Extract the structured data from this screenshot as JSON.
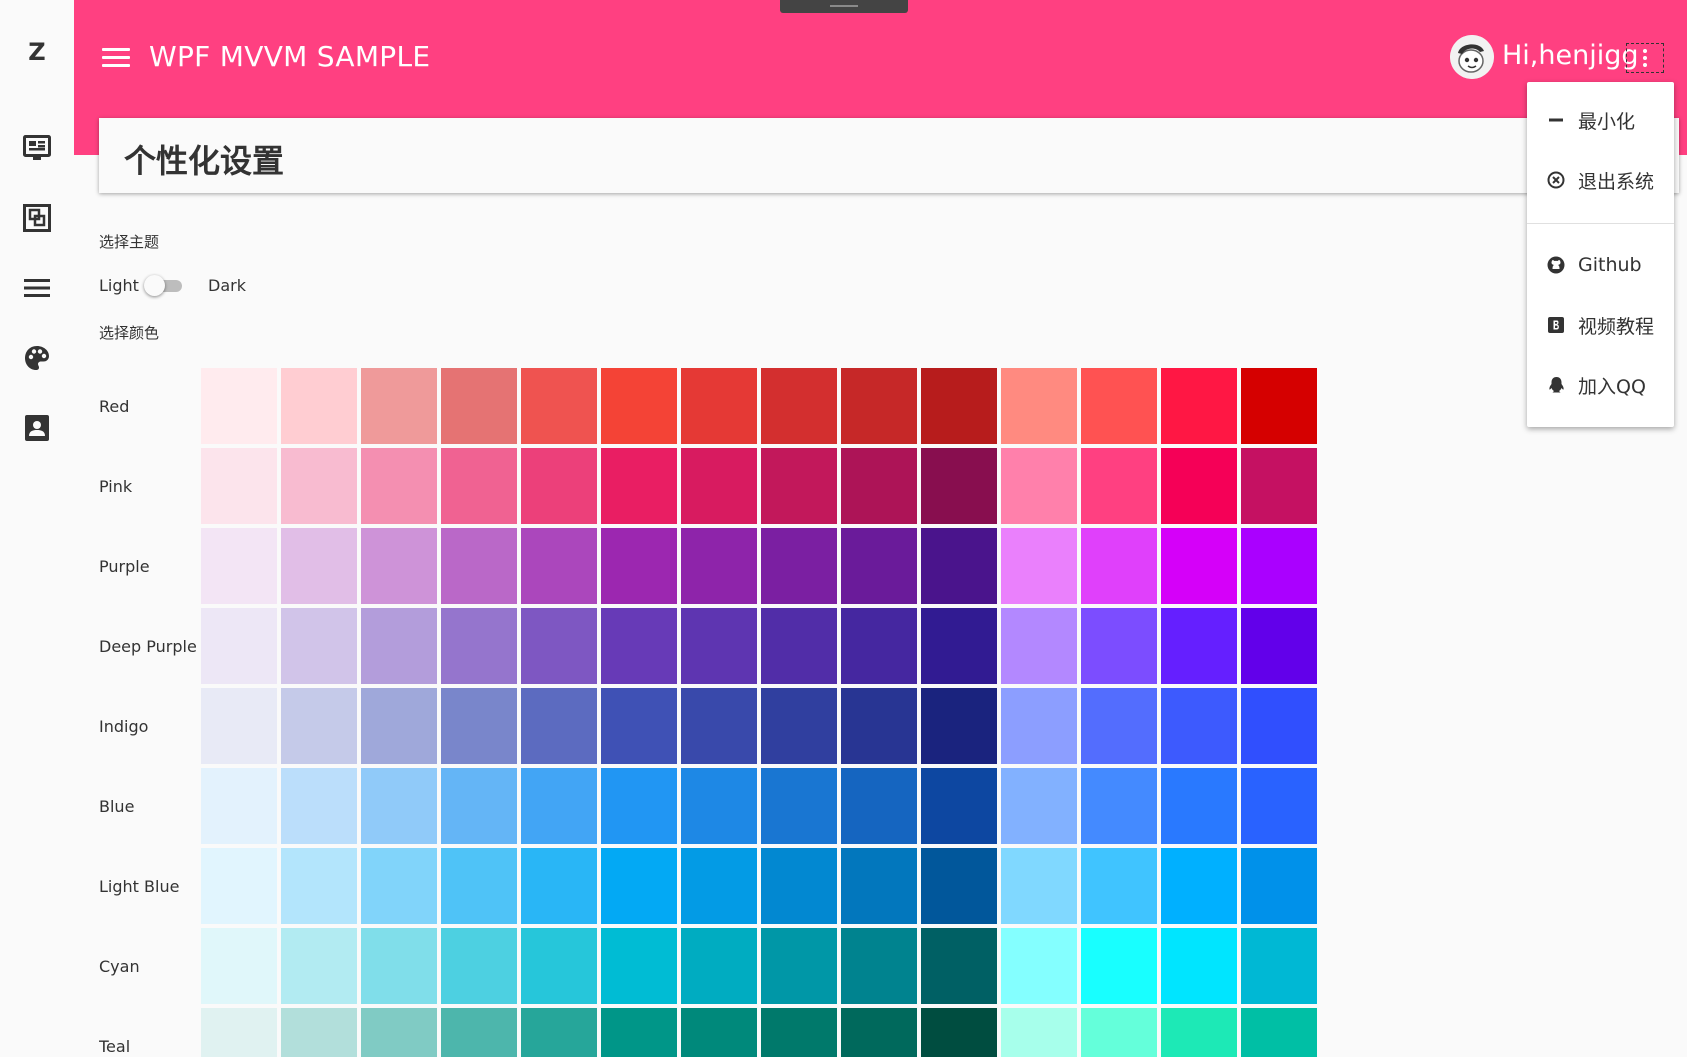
{
  "app": {
    "logo": "Z",
    "title": "WPF MVVM SAMPLE",
    "greeting": "Hi,henjigg",
    "accent_color": "#ff4081"
  },
  "sidebar": {
    "items": [
      {
        "icon": "dashboard-icon"
      },
      {
        "icon": "layers-icon"
      },
      {
        "icon": "menu-list-icon"
      },
      {
        "icon": "palette-icon"
      },
      {
        "icon": "contact-card-icon"
      }
    ]
  },
  "page": {
    "title": "个性化设置",
    "theme_label": "选择主题",
    "light_label": "Light",
    "dark_label": "Dark",
    "dark_mode_enabled": false,
    "color_label": "选择颜色"
  },
  "menu": {
    "items": [
      {
        "icon": "minimize-icon",
        "label": "最小化"
      },
      {
        "icon": "exit-circle-icon",
        "label": "退出系统"
      },
      {
        "icon": "github-icon",
        "label": "Github"
      },
      {
        "icon": "bilibili-icon",
        "label": "视频教程"
      },
      {
        "icon": "qq-icon",
        "label": "加入QQ"
      }
    ]
  },
  "palettes": [
    {
      "name": "Red",
      "colors": [
        "#ffebee",
        "#ffcdd2",
        "#ef9a9a",
        "#e57373",
        "#ef5350",
        "#f44336",
        "#e53935",
        "#d32f2f",
        "#c62828",
        "#b71c1c",
        "#ff8a80",
        "#ff5252",
        "#ff1744",
        "#d50000"
      ]
    },
    {
      "name": "Pink",
      "colors": [
        "#fce4ec",
        "#f8bbd0",
        "#f48fb1",
        "#f06292",
        "#ec407a",
        "#e91e63",
        "#d81b60",
        "#c2185b",
        "#ad1457",
        "#880e4f",
        "#ff80ab",
        "#ff4081",
        "#f50057",
        "#c51162"
      ]
    },
    {
      "name": "Purple",
      "colors": [
        "#f3e5f5",
        "#e1bee7",
        "#ce93d8",
        "#ba68c8",
        "#ab47bc",
        "#9c27b0",
        "#8e24aa",
        "#7b1fa2",
        "#6a1b9a",
        "#4a148c",
        "#ea80fc",
        "#e040fb",
        "#d500f9",
        "#aa00ff"
      ]
    },
    {
      "name": "Deep Purple",
      "colors": [
        "#ede7f6",
        "#d1c4e9",
        "#b39ddb",
        "#9575cd",
        "#7e57c2",
        "#673ab7",
        "#5e35b1",
        "#512da8",
        "#4527a0",
        "#311b92",
        "#b388ff",
        "#7c4dff",
        "#651fff",
        "#6200ea"
      ]
    },
    {
      "name": "Indigo",
      "colors": [
        "#e8eaf6",
        "#c5cae9",
        "#9fa8da",
        "#7986cb",
        "#5c6bc0",
        "#3f51b5",
        "#3949ab",
        "#303f9f",
        "#283593",
        "#1a237e",
        "#8c9eff",
        "#536dfe",
        "#3d5afe",
        "#304ffe"
      ]
    },
    {
      "name": "Blue",
      "colors": [
        "#e3f2fd",
        "#bbdefb",
        "#90caf9",
        "#64b5f6",
        "#42a5f5",
        "#2196f3",
        "#1e88e5",
        "#1976d2",
        "#1565c0",
        "#0d47a1",
        "#82b1ff",
        "#448aff",
        "#2979ff",
        "#2962ff"
      ]
    },
    {
      "name": "Light Blue",
      "colors": [
        "#e1f5fe",
        "#b3e5fc",
        "#81d4fa",
        "#4fc3f7",
        "#29b6f6",
        "#03a9f4",
        "#039be5",
        "#0288d1",
        "#0277bd",
        "#01579b",
        "#80d8ff",
        "#40c4ff",
        "#00b0ff",
        "#0091ea"
      ]
    },
    {
      "name": "Cyan",
      "colors": [
        "#e0f7fa",
        "#b2ebf2",
        "#80deea",
        "#4dd0e1",
        "#26c6da",
        "#00bcd4",
        "#00acc1",
        "#0097a7",
        "#00838f",
        "#006064",
        "#84ffff",
        "#18ffff",
        "#00e5ff",
        "#00b8d4"
      ]
    },
    {
      "name": "Teal",
      "colors": [
        "#e0f2f1",
        "#b2dfdb",
        "#80cbc4",
        "#4db6ac",
        "#26a69a",
        "#009688",
        "#00897b",
        "#00796b",
        "#00695c",
        "#004d40",
        "#a7ffeb",
        "#64ffda",
        "#1de9b6",
        "#00bfa5"
      ]
    }
  ]
}
